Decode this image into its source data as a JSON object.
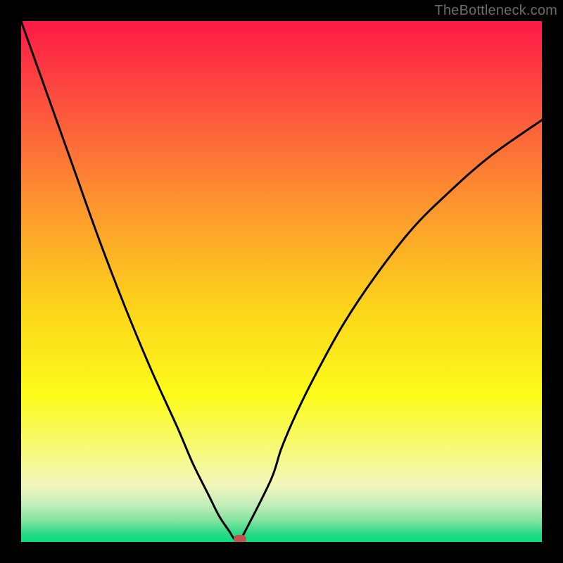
{
  "watermark": {
    "text": "TheBottleneck.com"
  },
  "chart_data": {
    "type": "line",
    "title": "",
    "xlabel": "",
    "ylabel": "",
    "xlim": [
      0,
      100
    ],
    "ylim": [
      0,
      100
    ],
    "x": [
      0,
      5,
      10,
      15,
      20,
      25,
      30,
      33,
      36,
      38,
      40,
      41,
      42,
      43,
      48,
      50,
      53,
      57,
      62,
      68,
      75,
      82,
      90,
      100
    ],
    "values": [
      100,
      86,
      72,
      58,
      45,
      33,
      22,
      15,
      9,
      5,
      2,
      0.5,
      0.5,
      2,
      12,
      18,
      25,
      33,
      42,
      51,
      60,
      67,
      74,
      81
    ],
    "minimum_marker": {
      "x": 42,
      "y": 0.5,
      "color": "#c1534d"
    },
    "gradient_stops": [
      {
        "offset": 0.0,
        "color": "#fd1a47"
      },
      {
        "offset": 0.15,
        "color": "#fd4e3f"
      },
      {
        "offset": 0.35,
        "color": "#fd942f"
      },
      {
        "offset": 0.55,
        "color": "#fcd41a"
      },
      {
        "offset": 0.72,
        "color": "#fcfc1a"
      },
      {
        "offset": 0.83,
        "color": "#f6f97f"
      },
      {
        "offset": 0.89,
        "color": "#f3f6bb"
      },
      {
        "offset": 0.93,
        "color": "#c1edba"
      },
      {
        "offset": 0.96,
        "color": "#7fe39e"
      },
      {
        "offset": 0.985,
        "color": "#28d885"
      },
      {
        "offset": 1.0,
        "color": "#06e07f"
      }
    ]
  }
}
